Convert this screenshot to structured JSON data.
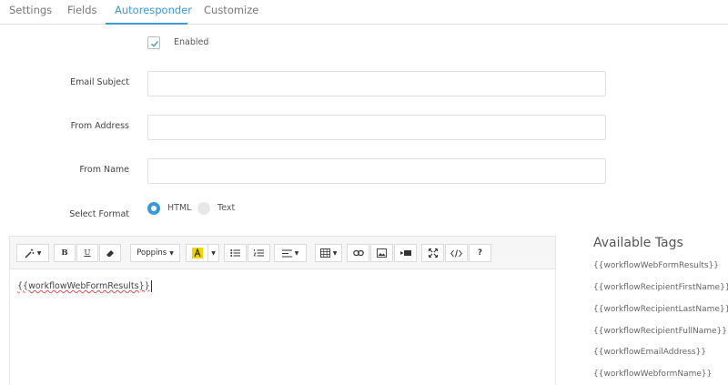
{
  "tabs": [
    {
      "label": "Settings"
    },
    {
      "label": "Fields"
    },
    {
      "label": "Autoresponder"
    },
    {
      "label": "Customize"
    }
  ],
  "enabled": {
    "label": "Enabled",
    "checked": true
  },
  "fields": {
    "email_subject": {
      "label": "Email Subject",
      "value": ""
    },
    "from_address": {
      "label": "From Address",
      "value": ""
    },
    "from_name": {
      "label": "From Name",
      "value": ""
    }
  },
  "format": {
    "label": "Select Format",
    "options": [
      {
        "label": "HTML",
        "selected": true
      },
      {
        "label": "Text",
        "selected": false
      }
    ]
  },
  "toolbar": {
    "font_name": "Poppins",
    "bold": "B",
    "underline": "U",
    "help": "?"
  },
  "editor": {
    "content": "{{workflowWebFormResults}}"
  },
  "available_tags": {
    "title": "Available Tags",
    "items": [
      "{{workflowWebFormResults}}",
      "{{workflowRecipientFirstName}}",
      "{{workflowRecipientLastName}}",
      "{{workflowRecipientFullName}}",
      "{{workflowEmailAddress}}",
      "{{workflowWebformName}}"
    ]
  },
  "colors": {
    "accent": "#3a9ad9",
    "highlight": "#f3d600"
  }
}
